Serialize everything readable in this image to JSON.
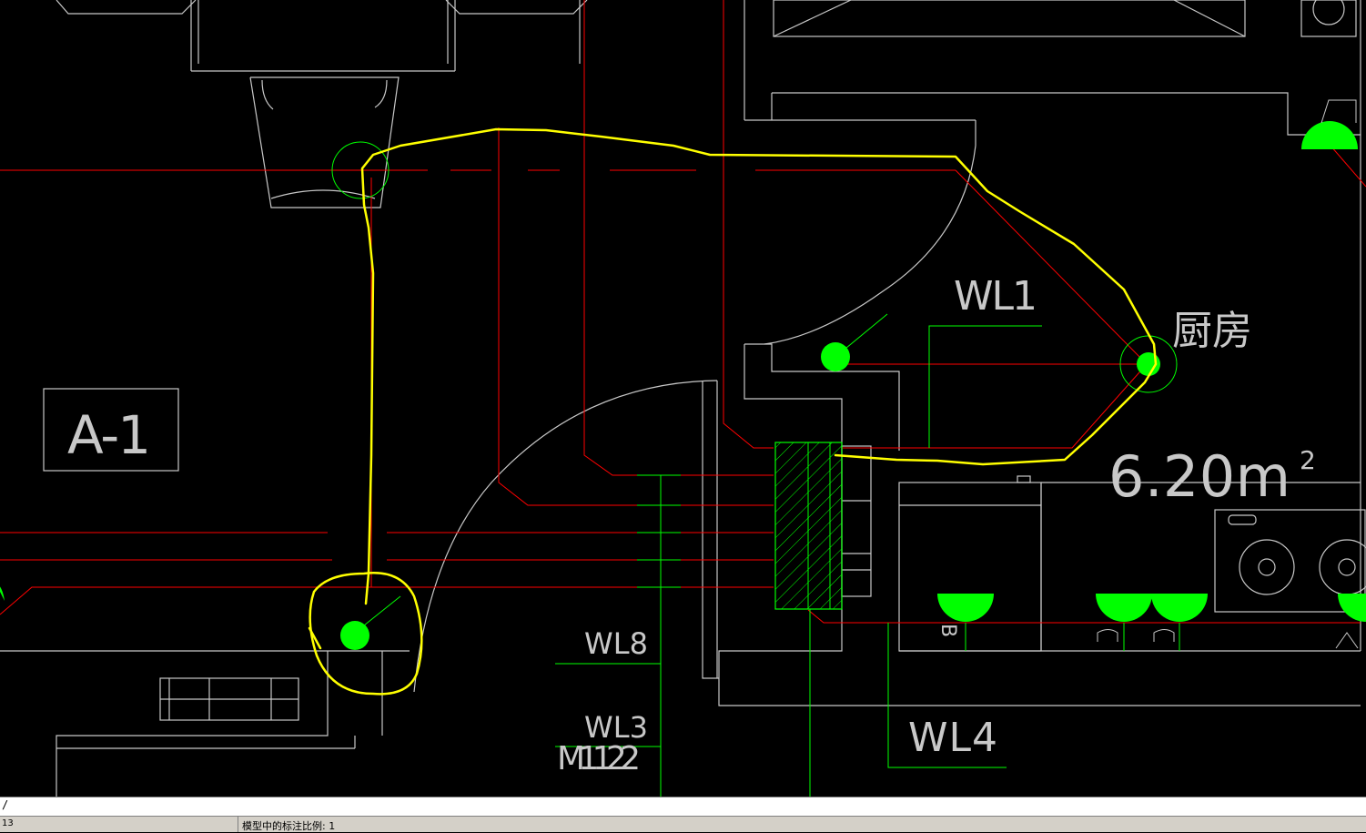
{
  "drawing": {
    "labels": {
      "wl1": "WL1",
      "wl8": "WL8",
      "wl3": "WL3",
      "wl4": "WL4",
      "m1122": "M1122",
      "room_name": "厨房",
      "area": "6.20m",
      "area_exp": "2",
      "tag_a1": "A-1",
      "fixture_b": "B"
    },
    "colors": {
      "background": "#000000",
      "wall": "#c8c8c8",
      "circuit": "#ff0000",
      "annotation": "#00ff00",
      "markup": "#ffff00"
    }
  },
  "command_line": {
    "prompt": "/"
  },
  "status_bar": {
    "coordinate": "13",
    "annotation_scale": "模型中的标注比例: 1"
  }
}
